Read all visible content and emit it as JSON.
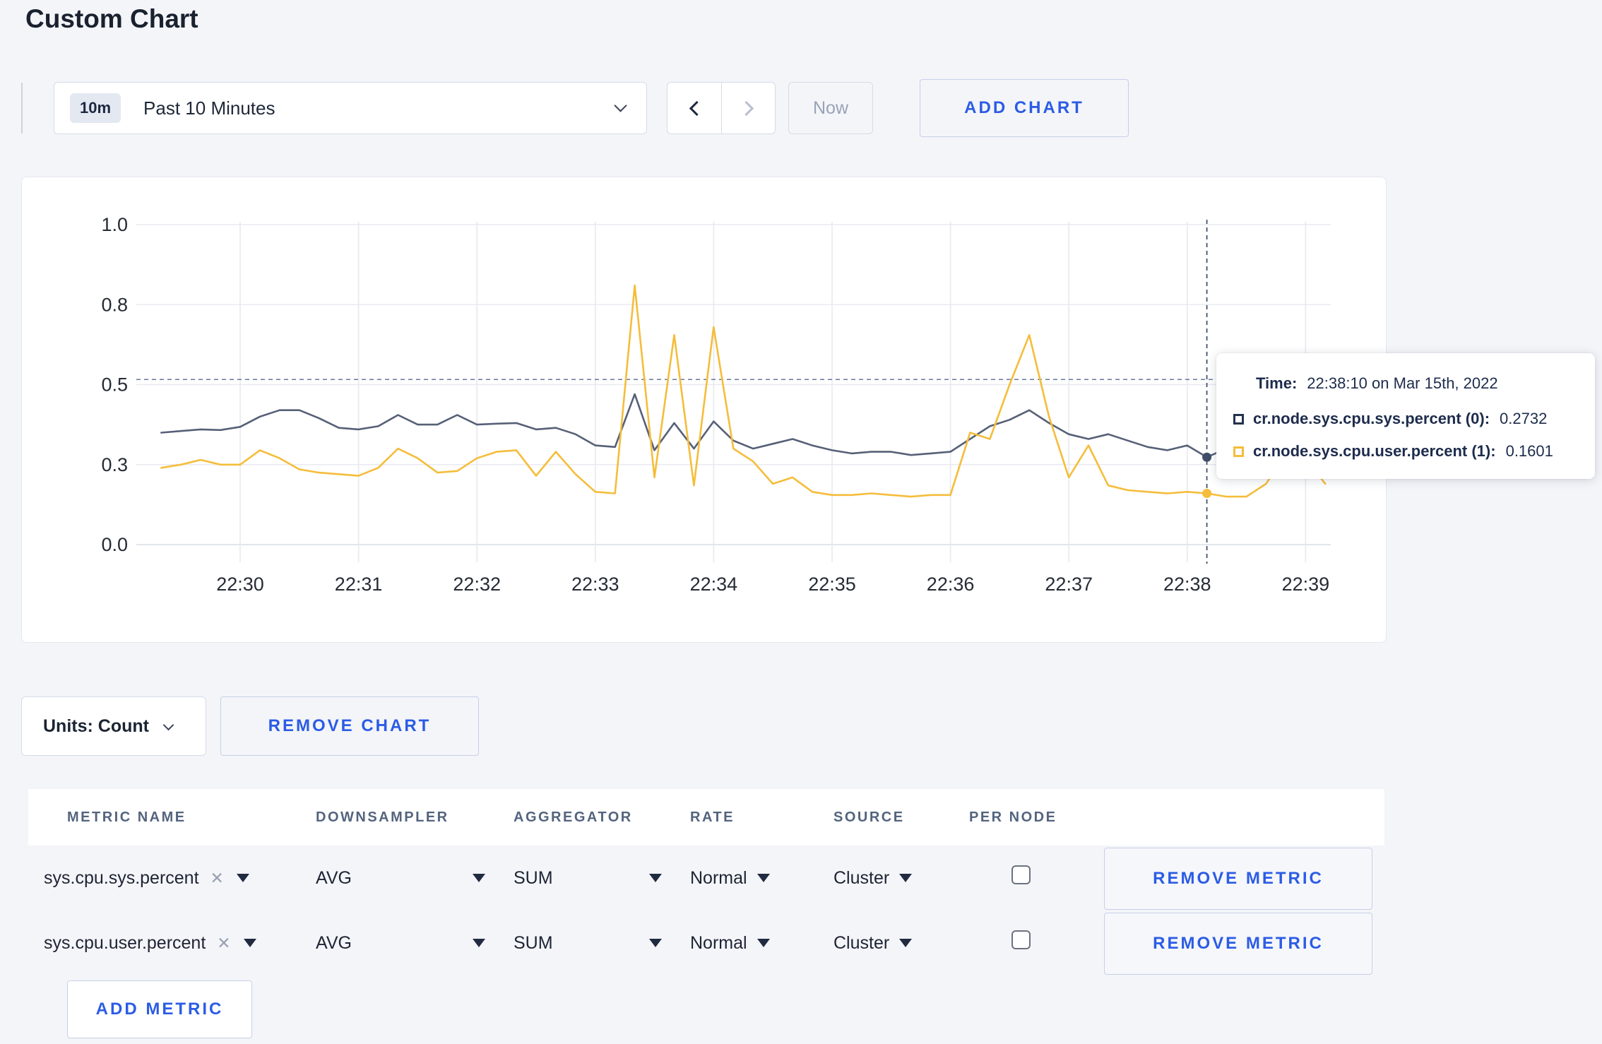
{
  "header": {
    "title": "Custom Chart"
  },
  "controls": {
    "range_badge": "10m",
    "range_label": "Past 10 Minutes",
    "now_label": "Now",
    "add_chart_label": "ADD CHART"
  },
  "chart_data": {
    "type": "line",
    "title": "",
    "xlabel": "",
    "ylabel": "",
    "ylim": [
      0,
      1
    ],
    "grid": true,
    "x": [
      "22:29:20",
      "22:29:30",
      "22:29:40",
      "22:29:50",
      "22:30:00",
      "22:30:10",
      "22:30:20",
      "22:30:30",
      "22:30:40",
      "22:30:50",
      "22:31:00",
      "22:31:10",
      "22:31:20",
      "22:31:30",
      "22:31:40",
      "22:31:50",
      "22:32:00",
      "22:32:10",
      "22:32:20",
      "22:32:30",
      "22:32:40",
      "22:32:50",
      "22:33:00",
      "22:33:10",
      "22:33:20",
      "22:33:30",
      "22:33:40",
      "22:33:50",
      "22:34:00",
      "22:34:10",
      "22:34:20",
      "22:34:30",
      "22:34:40",
      "22:34:50",
      "22:35:00",
      "22:35:10",
      "22:35:20",
      "22:35:30",
      "22:35:40",
      "22:35:50",
      "22:36:00",
      "22:36:10",
      "22:36:20",
      "22:36:30",
      "22:36:40",
      "22:36:50",
      "22:37:00",
      "22:37:10",
      "22:37:20",
      "22:37:30",
      "22:37:40",
      "22:37:50",
      "22:38:00",
      "22:38:10",
      "22:38:20",
      "22:38:30",
      "22:38:40",
      "22:38:50",
      "22:39:00",
      "22:39:10"
    ],
    "x_tick_labels": [
      "22:30",
      "22:31",
      "22:32",
      "22:33",
      "22:34",
      "22:35",
      "22:36",
      "22:37",
      "22:38",
      "22:39"
    ],
    "y_tick_labels": [
      "0.0",
      "0.3",
      "0.5",
      "0.8",
      "1.0"
    ],
    "y_tick_values": [
      0,
      0.25,
      0.5,
      0.75,
      1.0
    ],
    "series": [
      {
        "name": "cr.node.sys.cpu.sys.percent",
        "color": "#566077",
        "dot_color": "#414e68",
        "values": [
          0.35,
          0.355,
          0.36,
          0.358,
          0.368,
          0.4,
          0.42,
          0.42,
          0.395,
          0.365,
          0.36,
          0.37,
          0.405,
          0.375,
          0.375,
          0.405,
          0.375,
          0.378,
          0.38,
          0.36,
          0.365,
          0.345,
          0.31,
          0.305,
          0.47,
          0.295,
          0.38,
          0.3,
          0.385,
          0.325,
          0.3,
          0.315,
          0.33,
          0.31,
          0.295,
          0.285,
          0.29,
          0.29,
          0.28,
          0.285,
          0.29,
          0.33,
          0.37,
          0.39,
          0.42,
          0.38,
          0.345,
          0.33,
          0.345,
          0.325,
          0.305,
          0.295,
          0.31,
          0.2732,
          0.3,
          0.31,
          0.3,
          0.31,
          0.3,
          0.305
        ]
      },
      {
        "name": "cr.node.sys.cpu.user.percent",
        "color": "#f5bd3b",
        "dot_color": "#f5bd3b",
        "values": [
          0.24,
          0.25,
          0.265,
          0.25,
          0.25,
          0.295,
          0.27,
          0.235,
          0.225,
          0.22,
          0.215,
          0.24,
          0.3,
          0.27,
          0.225,
          0.23,
          0.27,
          0.29,
          0.295,
          0.215,
          0.29,
          0.22,
          0.165,
          0.16,
          0.81,
          0.21,
          0.655,
          0.185,
          0.68,
          0.3,
          0.26,
          0.19,
          0.21,
          0.165,
          0.155,
          0.155,
          0.16,
          0.155,
          0.15,
          0.155,
          0.155,
          0.35,
          0.33,
          0.5,
          0.655,
          0.4,
          0.21,
          0.31,
          0.185,
          0.17,
          0.165,
          0.16,
          0.165,
          0.1601,
          0.15,
          0.15,
          0.19,
          0.285,
          0.27,
          0.19
        ]
      }
    ],
    "crosshair": {
      "x_time": "22:38:10",
      "hline_value": 0.516
    },
    "legend_position": "tooltip"
  },
  "tooltip": {
    "time_label": "Time:",
    "time_value": "22:38:10 on Mar 15th, 2022",
    "rows": [
      {
        "label": "cr.node.sys.cpu.sys.percent (0):",
        "value": "0.2732",
        "color": "#24334d"
      },
      {
        "label": "cr.node.sys.cpu.user.percent (1):",
        "value": "0.1601",
        "color": "#f5bd3b"
      }
    ]
  },
  "under_chart": {
    "units_label": "Units: Count",
    "remove_chart_label": "REMOVE CHART"
  },
  "metrics": {
    "columns": [
      "METRIC NAME",
      "DOWNSAMPLER",
      "AGGREGATOR",
      "RATE",
      "SOURCE",
      "PER NODE"
    ],
    "rows": [
      {
        "name": "sys.cpu.sys.percent",
        "downsampler": "AVG",
        "aggregator": "SUM",
        "rate": "Normal",
        "source": "Cluster",
        "per_node_checked": false,
        "remove_label": "REMOVE METRIC"
      },
      {
        "name": "sys.cpu.user.percent",
        "downsampler": "AVG",
        "aggregator": "SUM",
        "rate": "Normal",
        "source": "Cluster",
        "per_node_checked": false,
        "remove_label": "REMOVE METRIC"
      }
    ],
    "add_metric_label": "ADD METRIC"
  },
  "icons": {
    "remove_x": "✕"
  },
  "colors": {
    "accent_blue": "#2b5ce5",
    "series_sys": "#566077",
    "series_user": "#f5bd3b",
    "page_bg": "#f4f5f9"
  }
}
